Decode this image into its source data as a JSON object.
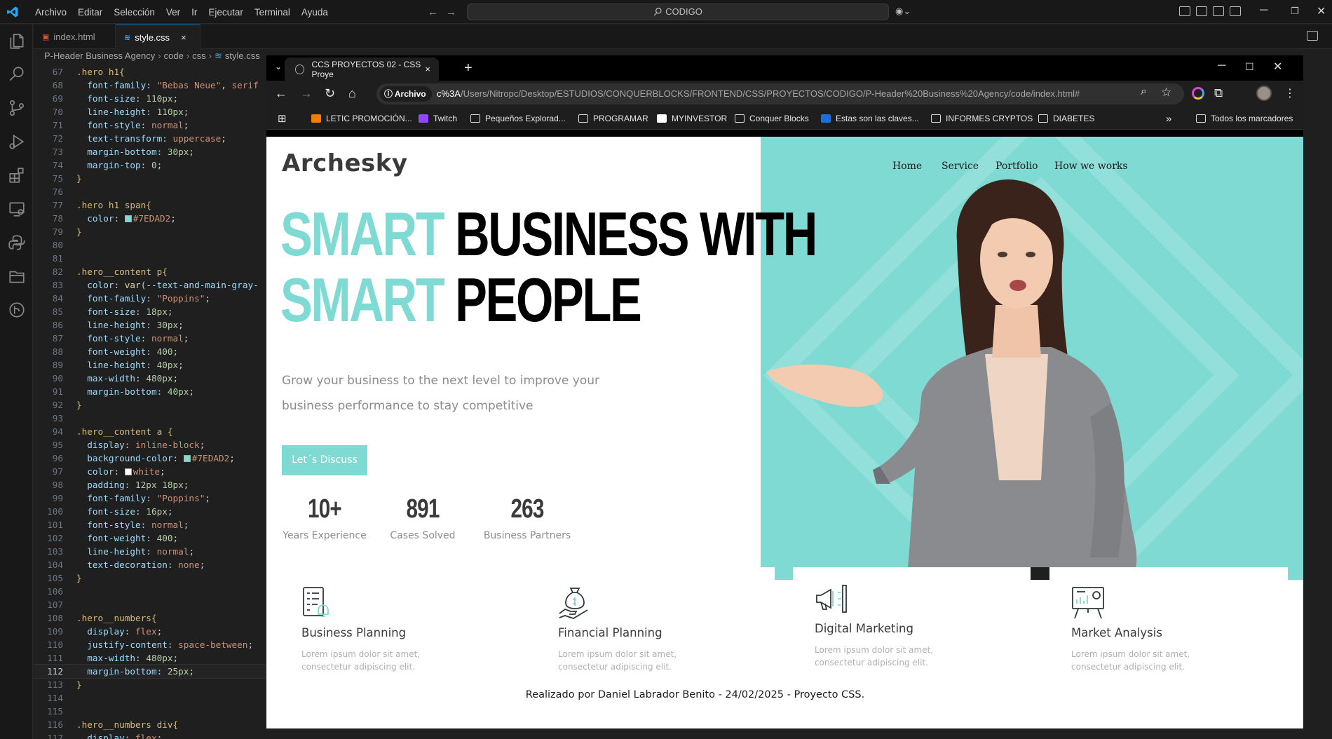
{
  "vscode": {
    "menu": [
      "Archivo",
      "Editar",
      "Selección",
      "Ver",
      "Ir",
      "Ejecutar",
      "Terminal",
      "Ayuda"
    ],
    "command_center": "CODIGO",
    "tabs": [
      {
        "label": "index.html",
        "icon": "html-file-icon",
        "color": "#e44d26"
      },
      {
        "label": "style.css",
        "icon": "css-file-icon",
        "color": "#4aa3df",
        "close": "×"
      }
    ],
    "breadcrumb": [
      "P-Header Business Agency",
      "code",
      "css",
      "style.css"
    ],
    "current_line": 112,
    "code_lines": [
      {
        "n": 67,
        "t": [
          [
            ".hero h1{",
            "sel"
          ]
        ]
      },
      {
        "n": 68,
        "t": [
          [
            "  font-family",
            "prop"
          ],
          [
            ": ",
            "punc"
          ],
          [
            "\"Bebas Neue\"",
            "val"
          ],
          [
            ", ",
            "punc"
          ],
          [
            "serif",
            "val"
          ]
        ]
      },
      {
        "n": 69,
        "t": [
          [
            "  font-size",
            "prop"
          ],
          [
            ": ",
            "punc"
          ],
          [
            "110px",
            "num"
          ],
          [
            ";",
            "punc"
          ]
        ]
      },
      {
        "n": 70,
        "t": [
          [
            "  line-height",
            "prop"
          ],
          [
            ": ",
            "punc"
          ],
          [
            "110px",
            "num"
          ],
          [
            ";",
            "punc"
          ]
        ]
      },
      {
        "n": 71,
        "t": [
          [
            "  font-style",
            "prop"
          ],
          [
            ": ",
            "punc"
          ],
          [
            "normal",
            "val"
          ],
          [
            ";",
            "punc"
          ]
        ]
      },
      {
        "n": 72,
        "t": [
          [
            "  text-transform",
            "prop"
          ],
          [
            ": ",
            "punc"
          ],
          [
            "uppercase",
            "val"
          ],
          [
            ";",
            "punc"
          ]
        ]
      },
      {
        "n": 73,
        "t": [
          [
            "  margin-bottom",
            "prop"
          ],
          [
            ": ",
            "punc"
          ],
          [
            "30px",
            "num"
          ],
          [
            ";",
            "punc"
          ]
        ]
      },
      {
        "n": 74,
        "t": [
          [
            "  margin-top",
            "prop"
          ],
          [
            ": ",
            "punc"
          ],
          [
            "0",
            "num"
          ],
          [
            ";",
            "punc"
          ]
        ]
      },
      {
        "n": 75,
        "t": [
          [
            "}",
            "sel"
          ]
        ]
      },
      {
        "n": 76,
        "t": []
      },
      {
        "n": 77,
        "t": [
          [
            ".hero h1 span{",
            "sel"
          ]
        ]
      },
      {
        "n": 78,
        "t": [
          [
            "  color",
            "prop"
          ],
          [
            ": ",
            "punc"
          ],
          [
            "#7EDAD2",
            "val",
            "#7EDAD2"
          ],
          [
            ";",
            "punc"
          ]
        ]
      },
      {
        "n": 79,
        "t": [
          [
            "}",
            "sel"
          ]
        ]
      },
      {
        "n": 80,
        "t": []
      },
      {
        "n": 81,
        "t": []
      },
      {
        "n": 82,
        "t": [
          [
            ".hero__content p{",
            "sel"
          ]
        ]
      },
      {
        "n": 83,
        "t": [
          [
            "  color",
            "prop"
          ],
          [
            ": ",
            "punc"
          ],
          [
            "var",
            "fn"
          ],
          [
            "(",
            "punc"
          ],
          [
            "--text-and-main-gray-",
            "prop"
          ]
        ]
      },
      {
        "n": 84,
        "t": [
          [
            "  font-family",
            "prop"
          ],
          [
            ": ",
            "punc"
          ],
          [
            "\"Poppins\"",
            "val"
          ],
          [
            ";",
            "punc"
          ]
        ]
      },
      {
        "n": 85,
        "t": [
          [
            "  font-size",
            "prop"
          ],
          [
            ": ",
            "punc"
          ],
          [
            "18px",
            "num"
          ],
          [
            ";",
            "punc"
          ]
        ]
      },
      {
        "n": 86,
        "t": [
          [
            "  line-height",
            "prop"
          ],
          [
            ": ",
            "punc"
          ],
          [
            "30px",
            "num"
          ],
          [
            ";",
            "punc"
          ]
        ]
      },
      {
        "n": 87,
        "t": [
          [
            "  font-style",
            "prop"
          ],
          [
            ": ",
            "punc"
          ],
          [
            "normal",
            "val"
          ],
          [
            ";",
            "punc"
          ]
        ]
      },
      {
        "n": 88,
        "t": [
          [
            "  font-weight",
            "prop"
          ],
          [
            ": ",
            "punc"
          ],
          [
            "400",
            "num"
          ],
          [
            ";",
            "punc"
          ]
        ]
      },
      {
        "n": 89,
        "t": [
          [
            "  line-height",
            "prop"
          ],
          [
            ": ",
            "punc"
          ],
          [
            "40px",
            "num"
          ],
          [
            ";",
            "punc"
          ]
        ]
      },
      {
        "n": 90,
        "t": [
          [
            "  max-width",
            "prop"
          ],
          [
            ": ",
            "punc"
          ],
          [
            "480px",
            "num"
          ],
          [
            ";",
            "punc"
          ]
        ]
      },
      {
        "n": 91,
        "t": [
          [
            "  margin-bottom",
            "prop"
          ],
          [
            ": ",
            "punc"
          ],
          [
            "40px",
            "num"
          ],
          [
            ";",
            "punc"
          ]
        ]
      },
      {
        "n": 92,
        "t": [
          [
            "}",
            "sel"
          ]
        ]
      },
      {
        "n": 93,
        "t": []
      },
      {
        "n": 94,
        "t": [
          [
            ".hero__content a {",
            "sel"
          ]
        ]
      },
      {
        "n": 95,
        "t": [
          [
            "  display",
            "prop"
          ],
          [
            ": ",
            "punc"
          ],
          [
            "inline-block",
            "val"
          ],
          [
            ";",
            "punc"
          ]
        ]
      },
      {
        "n": 96,
        "t": [
          [
            "  background-color",
            "prop"
          ],
          [
            ": ",
            "punc"
          ],
          [
            "#7EDAD2",
            "val",
            "#7EDAD2"
          ],
          [
            ";",
            "punc"
          ]
        ]
      },
      {
        "n": 97,
        "t": [
          [
            "  color",
            "prop"
          ],
          [
            ": ",
            "punc"
          ],
          [
            "white",
            "val",
            "#ffffff"
          ],
          [
            ";",
            "punc"
          ]
        ]
      },
      {
        "n": 98,
        "t": [
          [
            "  padding",
            "prop"
          ],
          [
            ": ",
            "punc"
          ],
          [
            "12px 18px",
            "num"
          ],
          [
            ";",
            "punc"
          ]
        ]
      },
      {
        "n": 99,
        "t": [
          [
            "  font-family",
            "prop"
          ],
          [
            ": ",
            "punc"
          ],
          [
            "\"Poppins\"",
            "val"
          ],
          [
            ";",
            "punc"
          ]
        ]
      },
      {
        "n": 100,
        "t": [
          [
            "  font-size",
            "prop"
          ],
          [
            ": ",
            "punc"
          ],
          [
            "16px",
            "num"
          ],
          [
            ";",
            "punc"
          ]
        ]
      },
      {
        "n": 101,
        "t": [
          [
            "  font-style",
            "prop"
          ],
          [
            ": ",
            "punc"
          ],
          [
            "normal",
            "val"
          ],
          [
            ";",
            "punc"
          ]
        ]
      },
      {
        "n": 102,
        "t": [
          [
            "  font-weight",
            "prop"
          ],
          [
            ": ",
            "punc"
          ],
          [
            "400",
            "num"
          ],
          [
            ";",
            "punc"
          ]
        ]
      },
      {
        "n": 103,
        "t": [
          [
            "  line-height",
            "prop"
          ],
          [
            ": ",
            "punc"
          ],
          [
            "normal",
            "val"
          ],
          [
            ";",
            "punc"
          ]
        ]
      },
      {
        "n": 104,
        "t": [
          [
            "  text-decoration",
            "prop"
          ],
          [
            ": ",
            "punc"
          ],
          [
            "none",
            "val"
          ],
          [
            ";",
            "punc"
          ]
        ]
      },
      {
        "n": 105,
        "t": [
          [
            "}",
            "sel"
          ]
        ]
      },
      {
        "n": 106,
        "t": []
      },
      {
        "n": 107,
        "t": []
      },
      {
        "n": 108,
        "t": [
          [
            ".hero__numbers{",
            "sel"
          ]
        ]
      },
      {
        "n": 109,
        "t": [
          [
            "  display",
            "prop"
          ],
          [
            ": ",
            "punc"
          ],
          [
            "flex",
            "val"
          ],
          [
            ";",
            "punc"
          ]
        ]
      },
      {
        "n": 110,
        "t": [
          [
            "  justify-content",
            "prop"
          ],
          [
            ": ",
            "punc"
          ],
          [
            "space-between",
            "val"
          ],
          [
            ";",
            "punc"
          ]
        ]
      },
      {
        "n": 111,
        "t": [
          [
            "  max-width",
            "prop"
          ],
          [
            ": ",
            "punc"
          ],
          [
            "480px",
            "num"
          ],
          [
            ";",
            "punc"
          ]
        ]
      },
      {
        "n": 112,
        "t": [
          [
            "  margin-bottom",
            "prop"
          ],
          [
            ": ",
            "punc"
          ],
          [
            "25px",
            "num"
          ],
          [
            ";",
            "punc"
          ]
        ]
      },
      {
        "n": 113,
        "t": [
          [
            "}",
            "sel"
          ]
        ]
      },
      {
        "n": 114,
        "t": []
      },
      {
        "n": 115,
        "t": []
      },
      {
        "n": 116,
        "t": [
          [
            ".hero__numbers div{",
            "sel"
          ]
        ]
      },
      {
        "n": 117,
        "t": [
          [
            "  display",
            "prop"
          ],
          [
            ": ",
            "punc"
          ],
          [
            "flex",
            "val"
          ],
          [
            ";",
            "punc"
          ]
        ]
      }
    ]
  },
  "browser": {
    "tab_title": "CCS PROYECTOS 02 - CSS Proye",
    "tab_close": "×",
    "new_tab": "+",
    "chip": "Archivo",
    "url_prefix": "c%3A",
    "url_rest": "/Users/Nitropc/Desktop/ESTUDIOS/CONQUERBLOCKS/FRONTEND/CSS/PROYECTOS/CODIGO/P-Header%20Business%20Agency/code/index.html#",
    "bookmarks": [
      {
        "label": "LETIC PROMOCIÓN...",
        "icon": "blogger-icon",
        "color": "#f57c00"
      },
      {
        "label": "Twitch",
        "icon": "twitch-icon",
        "color": "#9146ff"
      },
      {
        "label": "Pequeños Explorad...",
        "icon": "folder-icon"
      },
      {
        "label": "PROGRAMAR",
        "icon": "folder-icon"
      },
      {
        "label": "MYINVESTOR",
        "icon": "myinvestor-icon",
        "color": "#ffffff"
      },
      {
        "label": "Conquer Blocks",
        "icon": "folder-icon"
      },
      {
        "label": "Estas son las claves...",
        "icon": "site-icon",
        "color": "#1e6fd9"
      },
      {
        "label": "INFORMES CRYPTOS",
        "icon": "folder-icon"
      },
      {
        "label": "DIABETES",
        "icon": "folder-icon"
      }
    ],
    "more_bookmarks": "»",
    "all_bookmarks": "Todos los marcadores"
  },
  "site": {
    "logo": "Archesky",
    "accent": "#7EDAD2",
    "nav": [
      "Home",
      "Service",
      "Portfolio",
      "How we works"
    ],
    "headline": [
      {
        "accent": "SMART",
        "rest": "BUSINESS WITH"
      },
      {
        "accent": "SMART",
        "rest": "PEOPLE"
      }
    ],
    "subtitle": "Grow your business to the next level to improve your business performance to stay competitive",
    "cta": "Let´s Discuss",
    "numbers": [
      {
        "value": "10+",
        "label": "Years Experience"
      },
      {
        "value": "891",
        "label": "Cases Solved"
      },
      {
        "value": "263",
        "label": "Business Partners"
      }
    ],
    "services": [
      {
        "icon": "checklist-bell-icon",
        "title": "Business Planning",
        "desc": "Lorem ipsum dolor sit amet, consectetur adipiscing elit."
      },
      {
        "icon": "money-bag-hand-icon",
        "title": "Financial Planning",
        "desc": "Lorem ipsum dolor sit amet, consectetur adipiscing elit."
      },
      {
        "icon": "megaphone-icon",
        "title": "Digital Marketing",
        "desc": "Lorem ipsum dolor sit amet, consectetur adipiscing elit."
      },
      {
        "icon": "presentation-chart-icon",
        "title": "Market Analysis",
        "desc": "Lorem ipsum dolor sit amet, consectetur adipiscing elit."
      }
    ],
    "footer": "Realizado por Daniel Labrador Benito - 24/02/2025 - Proyecto CSS."
  }
}
